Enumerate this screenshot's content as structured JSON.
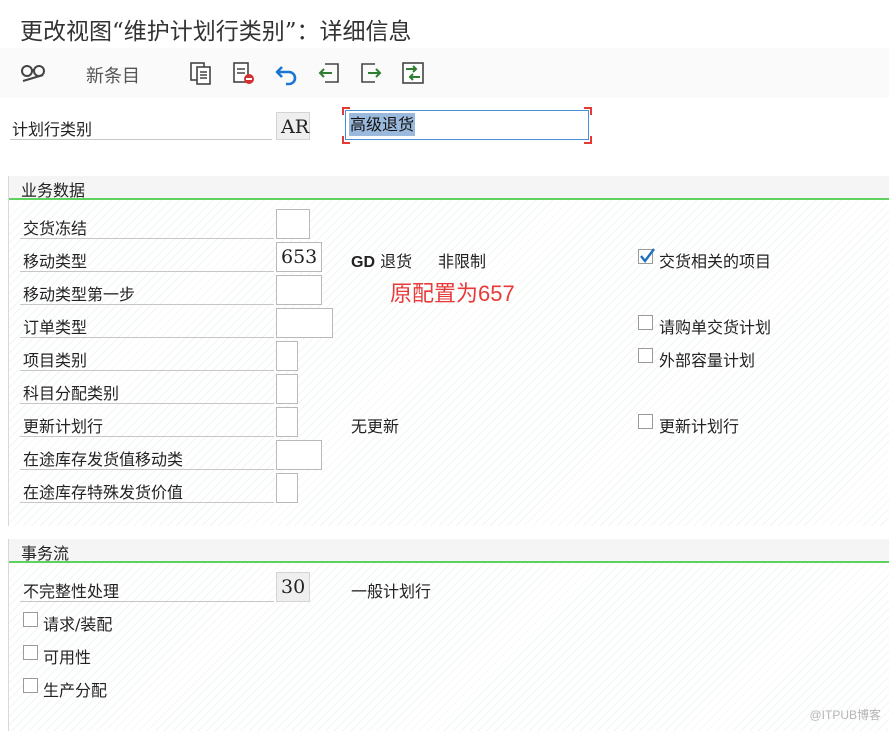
{
  "window": {
    "title": "更改视图“维护计划行类别”：详细信息"
  },
  "toolbar": {
    "new_entries_label": "新条目",
    "icons": [
      "glasses-edit-icon",
      "copy-icon",
      "delete-icon",
      "undo-icon",
      "previous-entry-icon",
      "next-entry-icon",
      "transport-icon"
    ]
  },
  "header": {
    "label": "计划行类别",
    "code": "AR",
    "description": "高级退货"
  },
  "business_data": {
    "title": "业务数据",
    "rows": [
      {
        "label": "交货冻结",
        "value": ""
      },
      {
        "label": "移动类型",
        "value": "653",
        "text1": "GD 退货",
        "text2": "非限制"
      },
      {
        "label": "移动类型第一步",
        "value": ""
      },
      {
        "label": "订单类型",
        "value": ""
      },
      {
        "label": "项目类别",
        "value": ""
      },
      {
        "label": "科目分配类别",
        "value": ""
      },
      {
        "label": "更新计划行",
        "value": "",
        "text1": "无更新"
      },
      {
        "label": "在途库存发货值移动类",
        "value": ""
      },
      {
        "label": "在途库存特殊发货价值",
        "value": ""
      }
    ],
    "checkboxes": [
      {
        "label": "交货相关的项目",
        "checked": true
      },
      {
        "label": "请购单交货计划",
        "checked": false
      },
      {
        "label": "外部容量计划",
        "checked": false
      },
      {
        "label": "更新计划行",
        "checked": false
      }
    ],
    "annotation": "原配置为657"
  },
  "transaction_flow": {
    "title": "事务流",
    "incompletion_label": "不完整性处理",
    "incompletion_value": "30",
    "incompletion_text": "一般计划行",
    "checkboxes": [
      {
        "label": "请求/装配",
        "checked": false
      },
      {
        "label": "可用性",
        "checked": false
      },
      {
        "label": "生产分配",
        "checked": false
      }
    ]
  },
  "watermark": "@ITPUB博客",
  "colors": {
    "group_line": "#5fd15f",
    "focus_bracket": "#e53935",
    "annotation": "#e83a3a",
    "checkmark": "#1f6fbf"
  }
}
